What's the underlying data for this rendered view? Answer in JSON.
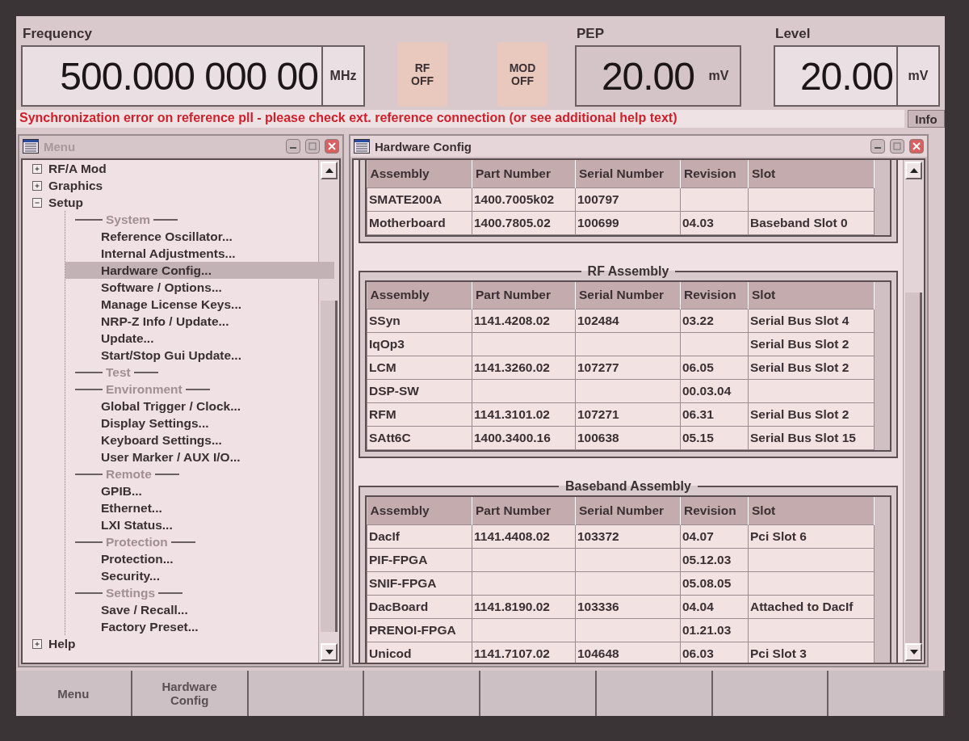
{
  "header": {
    "frequency": {
      "label": "Frequency",
      "value": "500.000 000 00",
      "unit": "MHz"
    },
    "toggles": [
      {
        "label": "RF OFF",
        "on": false
      },
      {
        "label": "MOD OFF",
        "on": false
      }
    ],
    "pep": {
      "label": "PEP",
      "value": "20.00",
      "unit": "mV"
    },
    "level": {
      "label": "Level",
      "value": "20.00",
      "unit": "mV"
    }
  },
  "message": {
    "text": "Synchronization error on reference pll - please check ext. reference connection (or see additional help text)",
    "button": "Info"
  },
  "menu_window": {
    "title": "Menu",
    "tree": [
      {
        "label": "RF/A Mod",
        "expanded": false
      },
      {
        "label": "Graphics",
        "expanded": false
      },
      {
        "label": "Setup",
        "expanded": true,
        "children": [
          {
            "kind": "heading",
            "label": "System"
          },
          {
            "kind": "item",
            "label": "Reference Oscillator...",
            "selected": false
          },
          {
            "kind": "item",
            "label": "Internal Adjustments...",
            "selected": false
          },
          {
            "kind": "item",
            "label": "Hardware Config...",
            "selected": true
          },
          {
            "kind": "item",
            "label": "Software / Options...",
            "selected": false
          },
          {
            "kind": "item",
            "label": "Manage License Keys...",
            "selected": false
          },
          {
            "kind": "item",
            "label": "NRP-Z Info / Update...",
            "selected": false
          },
          {
            "kind": "item",
            "label": "Update...",
            "selected": false
          },
          {
            "kind": "item",
            "label": "Start/Stop Gui Update...",
            "selected": false
          },
          {
            "kind": "heading",
            "label": "Test"
          },
          {
            "kind": "heading",
            "label": "Environment"
          },
          {
            "kind": "item",
            "label": "Global Trigger / Clock...",
            "selected": false
          },
          {
            "kind": "item",
            "label": "Display Settings...",
            "selected": false
          },
          {
            "kind": "item",
            "label": "Keyboard Settings...",
            "selected": false
          },
          {
            "kind": "item",
            "label": "User Marker / AUX I/O...",
            "selected": false
          },
          {
            "kind": "heading",
            "label": "Remote"
          },
          {
            "kind": "item",
            "label": "GPIB...",
            "selected": false
          },
          {
            "kind": "item",
            "label": "Ethernet...",
            "selected": false
          },
          {
            "kind": "item",
            "label": "LXI Status...",
            "selected": false
          },
          {
            "kind": "heading",
            "label": "Protection"
          },
          {
            "kind": "item",
            "label": "Protection...",
            "selected": false
          },
          {
            "kind": "item",
            "label": "Security...",
            "selected": false
          },
          {
            "kind": "heading",
            "label": "Settings"
          },
          {
            "kind": "item",
            "label": "Save / Recall...",
            "selected": false
          },
          {
            "kind": "item",
            "label": "Factory Preset...",
            "selected": false
          }
        ]
      },
      {
        "label": "Help",
        "expanded": false
      }
    ]
  },
  "hardware_window": {
    "title": "Hardware Config",
    "sections": [
      {
        "columns": [
          "Assembly",
          "Part Number",
          "Serial Number",
          "Revision",
          "Slot"
        ],
        "rows": [
          [
            "SMATE200A",
            "1400.7005k02",
            "100797",
            "",
            ""
          ],
          [
            "Motherboard",
            "1400.7805.02",
            "100699",
            "04.03",
            "Baseband Slot 0"
          ]
        ]
      },
      {
        "title": "RF Assembly",
        "columns": [
          "Assembly",
          "Part Number",
          "Serial Number",
          "Revision",
          "Slot"
        ],
        "rows": [
          [
            "SSyn",
            "1141.4208.02",
            "102484",
            "03.22",
            "Serial Bus Slot 4"
          ],
          [
            "IqOp3",
            "",
            "",
            "",
            "Serial Bus Slot 2"
          ],
          [
            "LCM",
            "1141.3260.02",
            "107277",
            "06.05",
            "Serial Bus Slot 2"
          ],
          [
            "DSP-SW",
            "",
            "",
            "00.03.04",
            ""
          ],
          [
            "RFM",
            "1141.3101.02",
            "107271",
            "06.31",
            "Serial Bus Slot 2"
          ],
          [
            "SAtt6C",
            "1400.3400.16",
            "100638",
            "05.15",
            "Serial Bus Slot 15"
          ]
        ]
      },
      {
        "title": "Baseband Assembly",
        "columns": [
          "Assembly",
          "Part Number",
          "Serial Number",
          "Revision",
          "Slot"
        ],
        "rows": [
          [
            "DacIf",
            "1141.4408.02",
            "103372",
            "04.07",
            "Pci Slot 6"
          ],
          [
            "PIF-FPGA",
            "",
            "",
            "05.12.03",
            ""
          ],
          [
            "SNIF-FPGA",
            "",
            "",
            "05.08.05",
            ""
          ],
          [
            "DacBoard",
            "1141.8190.02",
            "103336",
            "04.04",
            "Attached to DacIf"
          ],
          [
            "PRENOI-FPGA",
            "",
            "",
            "01.21.03",
            ""
          ],
          [
            "Unicod",
            "1141.7107.02",
            "104648",
            "06.03",
            "Pci Slot 3"
          ]
        ]
      }
    ]
  },
  "softkeys": [
    "Menu",
    "Hardware Config"
  ]
}
